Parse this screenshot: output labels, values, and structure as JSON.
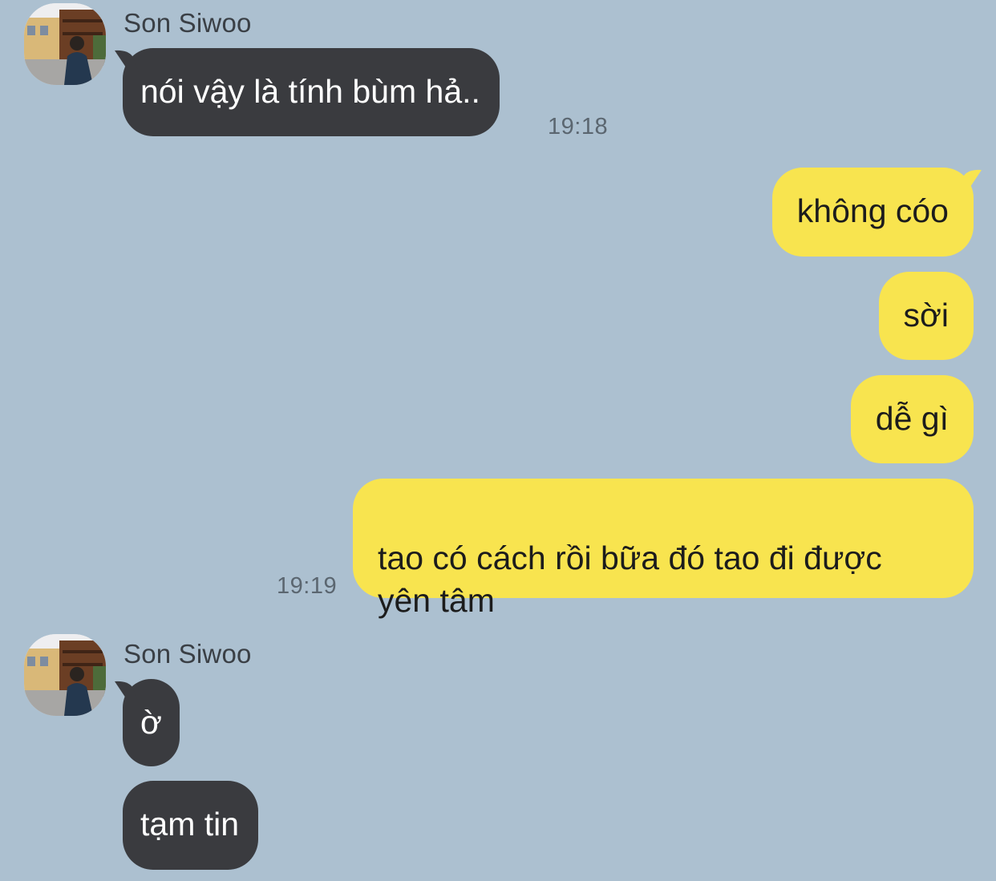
{
  "colors": {
    "background": "#acc0d0",
    "incoming_bubble": "#3a3b3f",
    "outgoing_bubble": "#f8e44f",
    "timestamp": "#5b6670"
  },
  "conversation": {
    "group1": {
      "sender": "Son Siwoo",
      "avatar_icon": "profile-photo-avatar",
      "messages": [
        {
          "text": "nói vậy là tính bùm hả.."
        }
      ],
      "time": "19:18"
    },
    "outgoing": {
      "messages": [
        {
          "text": "không cóo"
        },
        {
          "text": "sời"
        },
        {
          "text": "dễ gì"
        },
        {
          "text": "tao có cách rồi bữa đó tao đi được\nyên tâm"
        }
      ],
      "time": "19:19"
    },
    "group2": {
      "sender": "Son Siwoo",
      "avatar_icon": "profile-photo-avatar",
      "messages": [
        {
          "text": "ờ"
        },
        {
          "text": "tạm tin"
        }
      ]
    }
  }
}
